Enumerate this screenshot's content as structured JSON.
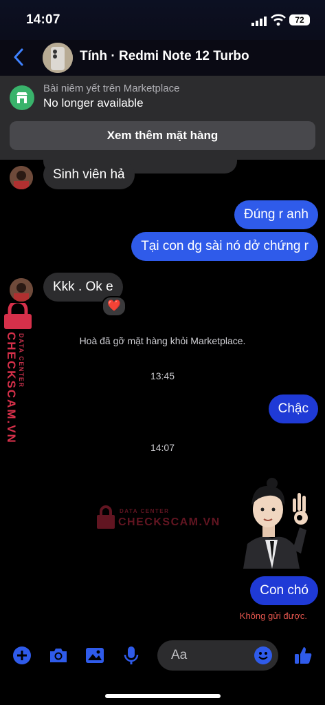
{
  "status": {
    "time": "14:07",
    "battery": "72"
  },
  "header": {
    "title": "Tính · Redmi Note 12 Turbo"
  },
  "marketplace": {
    "subtitle": "Bài niêm yết trên Marketplace",
    "status": "No longer available",
    "button": "Xem thêm mặt hàng"
  },
  "messages": [
    {
      "text": "Sinh viên hả"
    },
    {
      "text": "Đúng r anh"
    },
    {
      "text": "Tại con dg sài nó dở chứng r"
    },
    {
      "text": "Kkk . Ok e",
      "reaction": "❤️"
    },
    {
      "text": "Chậc"
    },
    {
      "text": "Con chó"
    }
  ],
  "system_notice": "Hoà đã gỡ mặt hàng khỏi Marketplace.",
  "timestamps": [
    "13:45",
    "14:07"
  ],
  "send_error": "Không gửi được.",
  "watermark": {
    "label": "DATA CENTER",
    "brand": "CHECKSCAM.VN"
  },
  "composer": {
    "placeholder": "Aa"
  },
  "colors": {
    "accent": "#2f5bea",
    "sticker_outgoing": "#1f3ad6",
    "error": "#e8574f",
    "marketplace_green": "#39b36b"
  },
  "icons": [
    "back-icon",
    "store-icon",
    "plus-icon",
    "camera-icon",
    "image-icon",
    "microphone-icon",
    "emoji-icon",
    "like-icon",
    "lock-icon"
  ]
}
